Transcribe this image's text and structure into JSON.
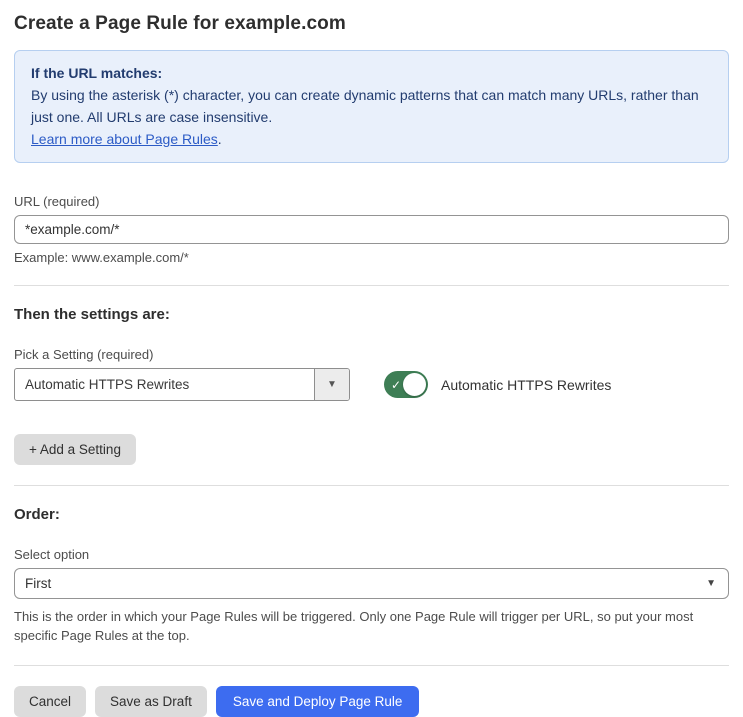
{
  "page": {
    "title": "Create a Page Rule for example.com"
  },
  "info_box": {
    "heading": "If the URL matches:",
    "body": "By using the asterisk (*) character, you can create dynamic patterns that can match many URLs, rather than just one. All URLs are case insensitive.",
    "link_text": "Learn more about Page Rules",
    "link_suffix": "."
  },
  "url_field": {
    "label": "URL (required)",
    "value": "*example.com/*",
    "example": "Example: www.example.com/*"
  },
  "settings_section": {
    "heading": "Then the settings are:",
    "pick_label": "Pick a Setting (required)",
    "dropdown_value": "Automatic HTTPS Rewrites",
    "dropdown_arrow": "▼",
    "toggle_state": "on",
    "toggle_check": "✓",
    "toggle_label": "Automatic HTTPS Rewrites",
    "add_button_label": "+ Add a Setting"
  },
  "order_section": {
    "heading": "Order:",
    "label": "Select option",
    "selected_option": "First",
    "select_arrow": "▼",
    "help": "This is the order in which your Page Rules will be triggered. Only one Page Rule will trigger per URL, so put your most specific Page Rules at the top."
  },
  "actions": {
    "cancel_label": "Cancel",
    "save_draft_label": "Save as Draft",
    "save_deploy_label": "Save and Deploy Page Rule"
  },
  "colors": {
    "info_box_bg": "#e9f0fb",
    "info_box_border": "#b6cff0",
    "info_box_text": "#223c6f",
    "link_blue": "#2c5bc6",
    "toggle_green": "#3e7e55",
    "primary_button_blue": "#3d6cf0",
    "gray_button_bg": "#dcdcdc"
  }
}
